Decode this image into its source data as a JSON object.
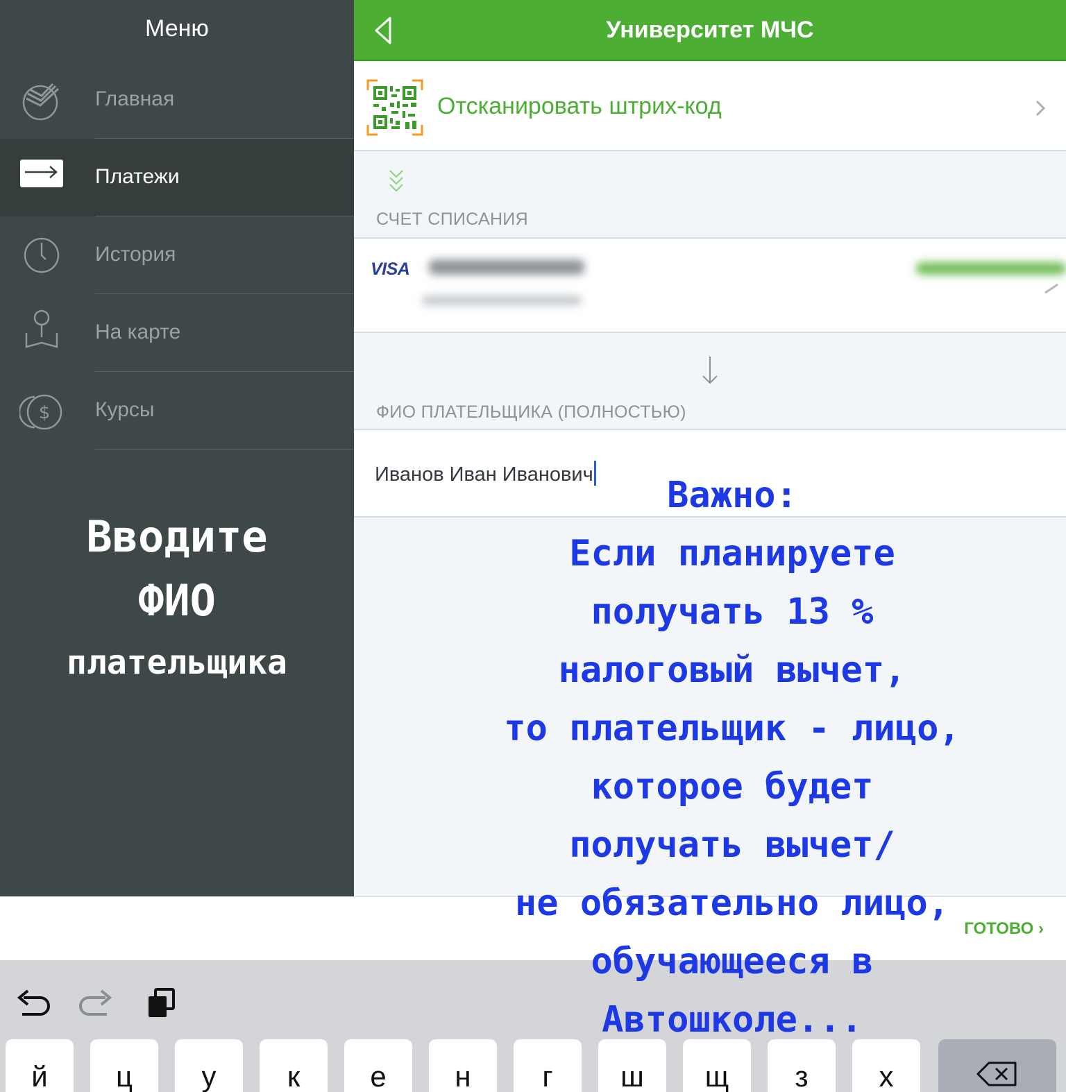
{
  "sidebar": {
    "title": "Меню",
    "items": [
      {
        "label": "Главная",
        "icon": "sberbank-logo-icon"
      },
      {
        "label": "Платежи",
        "icon": "payment-card-icon",
        "active": true
      },
      {
        "label": "История",
        "icon": "clock-icon"
      },
      {
        "label": "На карте",
        "icon": "map-pin-icon"
      },
      {
        "label": "Курсы",
        "icon": "currency-icon"
      }
    ],
    "note": [
      "Вводите",
      "ФИО",
      "плательщика"
    ]
  },
  "header": {
    "title": "Университет МЧС",
    "back_icon": "back-arrow-icon"
  },
  "scan": {
    "label": "Отсканировать штрих-код",
    "icon": "qr-code-icon"
  },
  "account": {
    "section_label": "СЧЕТ СПИСАНИЯ",
    "card_brand": "VISA"
  },
  "payer": {
    "section_label": "ФИО ПЛАТЕЛЬЩИКА (ПОЛНОСТЬЮ)",
    "value": "Иванов Иван Иванович"
  },
  "overlay_note": [
    "Важно:",
    "Если планируете",
    "получать 13 %",
    "налоговый вычет,",
    "то плательщик - лицо,",
    "которое будет",
    "получать вычет/",
    "не обязательно лицо,",
    "обучающееся в",
    "Автошколе..."
  ],
  "keyboard": {
    "done_label": "ГОТОВО",
    "keys": [
      "й",
      "ц",
      "у",
      "к",
      "е",
      "н",
      "г",
      "ш",
      "щ",
      "з",
      "х"
    ]
  },
  "colors": {
    "accent": "#4caf34",
    "sidebar_bg": "#3e4848",
    "annotation": "#1d39e6"
  }
}
